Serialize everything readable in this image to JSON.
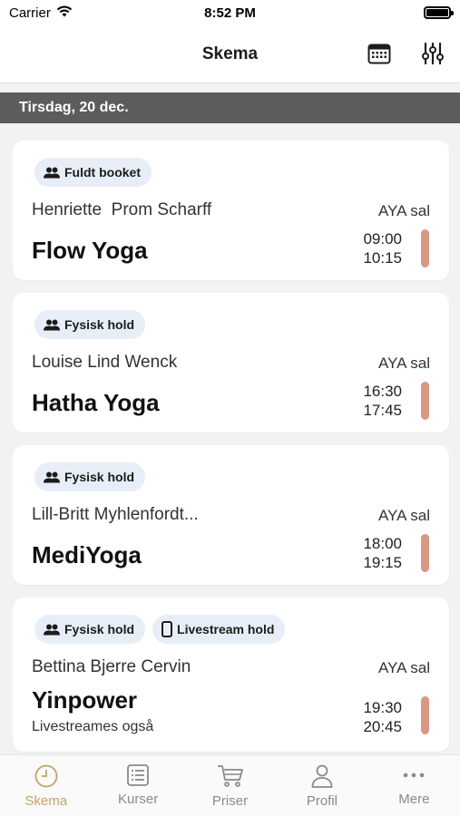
{
  "status_bar": {
    "carrier": "Carrier",
    "time": "8:52 PM"
  },
  "nav": {
    "title": "Skema",
    "calendar_icon": "calendar-icon",
    "filter_icon": "sliders-icon"
  },
  "date_header": "Tirsdag, 20 dec.",
  "colors": {
    "accent": "#c7a166",
    "indicator": "#d99886",
    "badge_bg": "#e7eef8",
    "date_header_bg": "#5c5c5c"
  },
  "classes": [
    {
      "badges": [
        {
          "icon": "people-icon",
          "label": "Fuldt booket"
        }
      ],
      "teacher": "Henriette  Prom Scharff",
      "room": "AYA sal",
      "name": "Flow Yoga",
      "start": "09:00",
      "end": "10:15"
    },
    {
      "badges": [
        {
          "icon": "people-icon",
          "label": "Fysisk hold"
        }
      ],
      "teacher": "Louise Lind Wenck",
      "room": "AYA sal",
      "name": "Hatha Yoga",
      "start": "16:30",
      "end": "17:45"
    },
    {
      "badges": [
        {
          "icon": "people-icon",
          "label": "Fysisk hold"
        }
      ],
      "teacher": "Lill-Britt Myhlenfordt...",
      "room": "AYA sal",
      "name": "MediYoga",
      "start": "18:00",
      "end": "19:15"
    },
    {
      "badges": [
        {
          "icon": "people-icon",
          "label": "Fysisk hold"
        },
        {
          "icon": "phone-icon",
          "label": "Livestream hold"
        }
      ],
      "teacher": "Bettina Bjerre Cervin",
      "room": "AYA sal",
      "name": "Yinpower",
      "note": "Livestreames også",
      "start": "19:30",
      "end": "20:45"
    }
  ],
  "tabs": [
    {
      "label": "Skema",
      "icon": "clock-icon",
      "active": true
    },
    {
      "label": "Kurser",
      "icon": "list-icon",
      "active": false
    },
    {
      "label": "Priser",
      "icon": "cart-icon",
      "active": false
    },
    {
      "label": "Profil",
      "icon": "person-icon",
      "active": false
    },
    {
      "label": "Mere",
      "icon": "more-icon",
      "active": false
    }
  ]
}
